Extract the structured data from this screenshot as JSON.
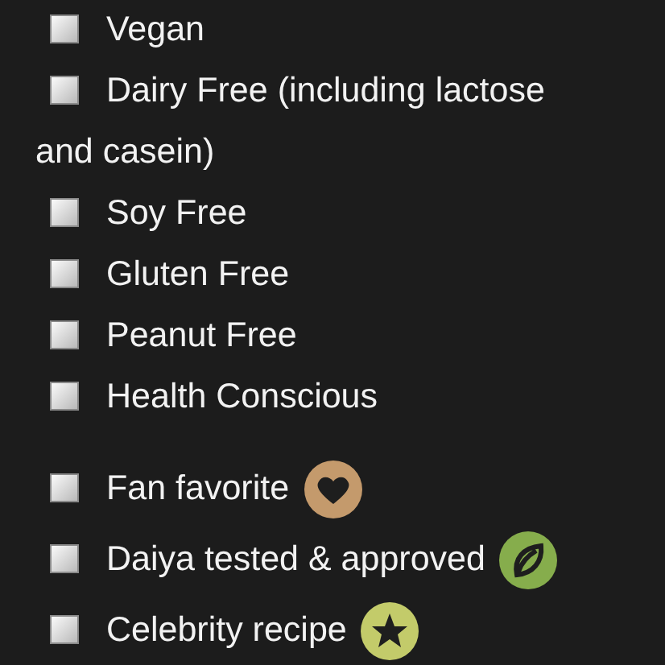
{
  "filters": [
    {
      "label": "Vegan",
      "checked": false
    },
    {
      "label": "Dairy Free (including lactose",
      "label_continued": "and casein)",
      "checked": false
    },
    {
      "label": "Soy Free",
      "checked": false
    },
    {
      "label": "Gluten Free",
      "checked": false
    },
    {
      "label": "Peanut Free",
      "checked": false
    },
    {
      "label": "Health Conscious",
      "checked": false
    }
  ],
  "features": [
    {
      "label": "Fan favorite",
      "checked": false,
      "kind": "heart"
    },
    {
      "label": "Daiya tested & approved",
      "checked": false,
      "kind": "leaf"
    },
    {
      "label": "Celebrity recipe",
      "checked": false,
      "kind": "star"
    }
  ]
}
